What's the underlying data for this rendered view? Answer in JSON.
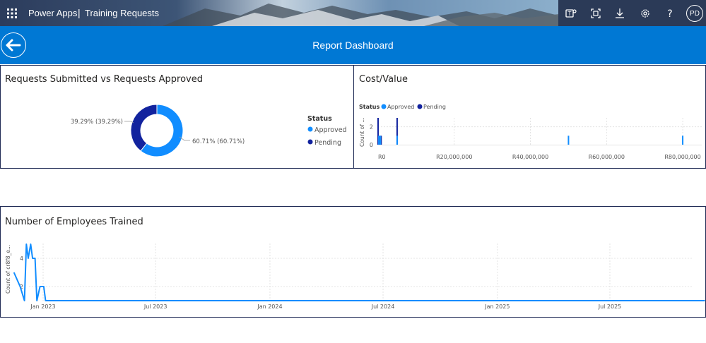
{
  "topbar": {
    "app_name": "Power Apps",
    "separator": "|",
    "app_title": "Training Requests",
    "icons": [
      "waffle-icon",
      "teams-icon",
      "fit-screen-icon",
      "download-icon",
      "settings-icon",
      "help-icon"
    ],
    "avatar_initials": "PD"
  },
  "header": {
    "title": "Report Dashboard"
  },
  "colors": {
    "approved": "#118dff",
    "pending": "#12239e",
    "header": "#0078d4",
    "border": "#1f2a55"
  },
  "panel1": {
    "title": "Requests Submitted vs Requests Approved",
    "legend_title": "Status",
    "legend_items": [
      "Approved",
      "Pending"
    ],
    "label_approved": "60.71% (60.71%)",
    "label_pending": "39.29% (39.29%)"
  },
  "panel2": {
    "title": "Cost/Value",
    "legend_title": "Status",
    "legend_items": [
      "Approved",
      "Pending"
    ],
    "ylabel": "Count of ...",
    "yticks": [
      "0",
      "2"
    ],
    "xticks": [
      "R0",
      "R20,000,000",
      "R40,000,000",
      "R60,000,000",
      "R80,000,000"
    ]
  },
  "panel3": {
    "title": "Number of Employees Trained",
    "ylabel": "Count of cr8f8_e...",
    "yticks": [
      "2",
      "4"
    ],
    "xticks": [
      "Jan 2023",
      "Jul 2023",
      "Jan 2024",
      "Jul 2024",
      "Jan 2025",
      "Jul 2025"
    ]
  },
  "chart_data": [
    {
      "type": "pie",
      "title": "Requests Submitted vs Requests Approved",
      "legend_title": "Status",
      "categories": [
        "Approved",
        "Pending"
      ],
      "values": [
        60.71,
        39.29
      ],
      "legend_position": "right"
    },
    {
      "type": "bar",
      "title": "Cost/Value",
      "legend_title": "Status",
      "ylabel": "Count of ...",
      "x_range": [
        0,
        85000000
      ],
      "ylim": [
        0,
        3
      ],
      "series": [
        {
          "name": "Pending",
          "x": [
            0,
            400000,
            800000,
            5000000
          ],
          "values": [
            3,
            1,
            1,
            3
          ]
        },
        {
          "name": "Approved",
          "x": [
            200000,
            600000,
            5000000,
            50000000,
            80000000
          ],
          "values": [
            1,
            1,
            1,
            1,
            1
          ]
        }
      ],
      "grid": true,
      "legend_position": "top-left"
    },
    {
      "type": "line",
      "title": "Number of Employees Trained",
      "ylabel": "Count of cr8f8_e...",
      "x": [
        "2022-11-15",
        "2022-11-25",
        "2022-12-02",
        "2022-12-05",
        "2022-12-08",
        "2022-12-12",
        "2022-12-15",
        "2022-12-19",
        "2022-12-22",
        "2022-12-27",
        "2023-01-02",
        "2023-01-05",
        "2023-01-10",
        "2023-01-20",
        "2023-02-01",
        "2025-12-01"
      ],
      "values": [
        3,
        2,
        1,
        5,
        4,
        5,
        4,
        4,
        1,
        2,
        2,
        1,
        1,
        1,
        1,
        1
      ],
      "ylim": [
        1,
        5
      ],
      "grid": true
    }
  ]
}
